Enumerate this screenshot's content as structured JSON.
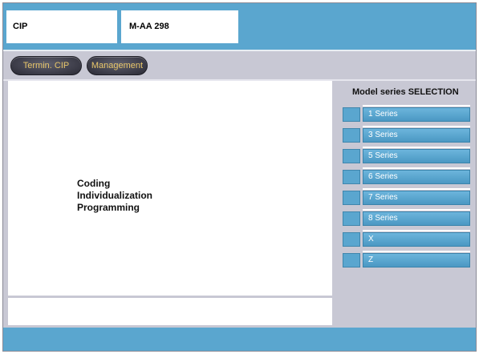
{
  "header": {
    "left_title": "CIP",
    "right_title": "M-AA 298"
  },
  "toolbar": {
    "buttons": [
      {
        "label": "Termin. CIP"
      },
      {
        "label": "Management"
      }
    ]
  },
  "main": {
    "lines": [
      "Coding",
      "Individualization",
      "Programming"
    ]
  },
  "selection": {
    "title": "Model series SELECTION",
    "items": [
      {
        "label": "1 Series"
      },
      {
        "label": "3 Series"
      },
      {
        "label": "5 Series"
      },
      {
        "label": "6 Series"
      },
      {
        "label": "7 Series"
      },
      {
        "label": "8 Series"
      },
      {
        "label": "X"
      },
      {
        "label": "Z"
      }
    ]
  },
  "colors": {
    "header_blue": "#5aa6cf",
    "panel_gray": "#c8c8d4",
    "pill_text": "#e8c66a"
  }
}
